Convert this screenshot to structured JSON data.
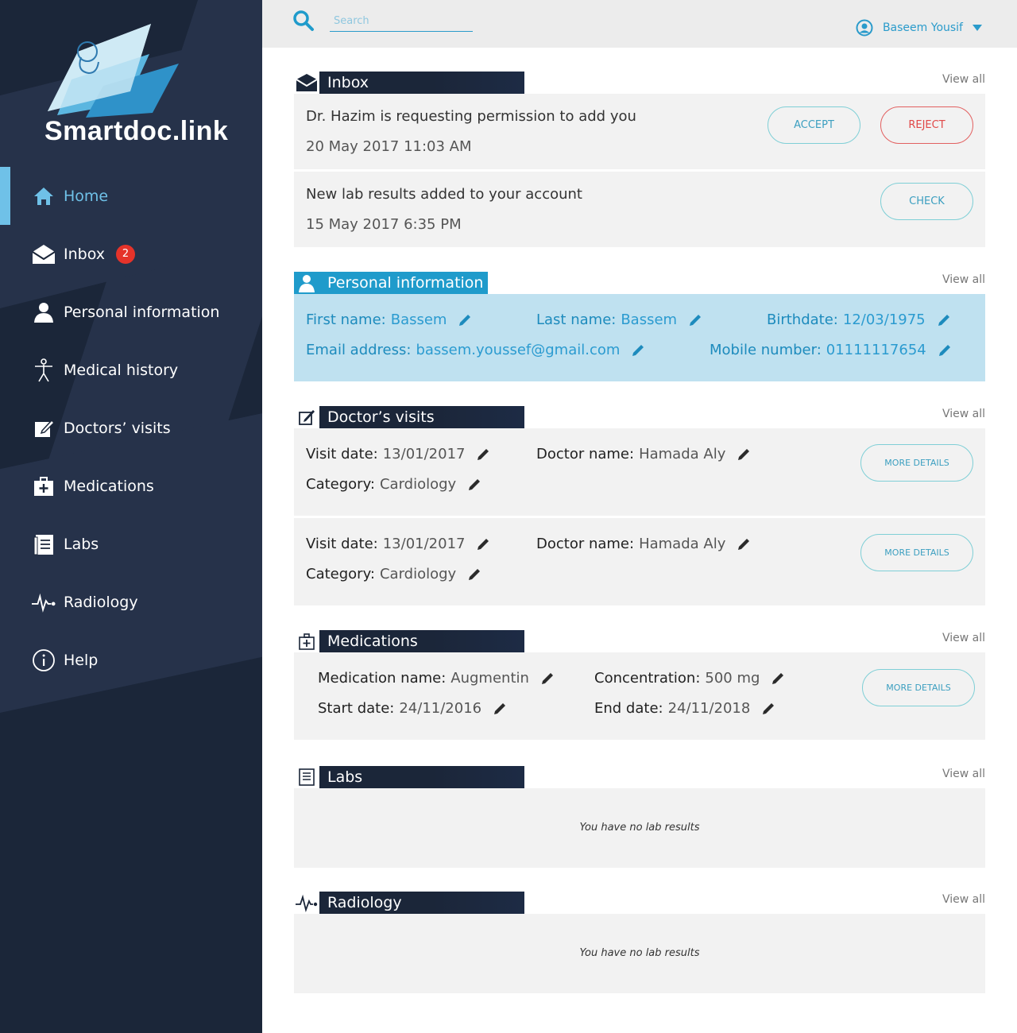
{
  "brand": {
    "name": "Smartdoc.link"
  },
  "sidebar": {
    "items": [
      {
        "label": "Home",
        "icon": "home-icon"
      },
      {
        "label": "Inbox",
        "icon": "envelope-icon",
        "badge": "2"
      },
      {
        "label": "Personal information",
        "icon": "person-icon"
      },
      {
        "label": "Medical history",
        "icon": "body-icon"
      },
      {
        "label": "Doctors’ visits",
        "icon": "edit-icon"
      },
      {
        "label": "Medications",
        "icon": "medkit-icon"
      },
      {
        "label": "Labs",
        "icon": "labs-icon"
      },
      {
        "label": "Radiology",
        "icon": "pulse-icon"
      },
      {
        "label": "Help",
        "icon": "info-icon"
      }
    ]
  },
  "topbar": {
    "search_placeholder": "Search",
    "user_name": "Baseem Yousif"
  },
  "common": {
    "view_all": "View all"
  },
  "inbox": {
    "title": "Inbox",
    "items": [
      {
        "message": "Dr. Hazim is requesting permission to add you",
        "date": "20 May 2017 11:03 AM",
        "accept": "ACCEPT",
        "reject": "REJECT"
      },
      {
        "message": "New lab results added to your account",
        "date": "15 May 2017 6:35 PM",
        "check": "CHECK"
      }
    ]
  },
  "personal": {
    "title": "Personal information",
    "first_name_label": "First name:",
    "first_name": "Bassem",
    "last_name_label": "Last name:",
    "last_name": "Bassem",
    "birthdate_label": "Birthdate:",
    "birthdate": "12/03/1975",
    "email_label": "Email address:",
    "email": "bassem.youssef@gmail.com",
    "mobile_label": "Mobile number:",
    "mobile": "01111117654"
  },
  "visits": {
    "title": "Doctor’s visits",
    "items": [
      {
        "visit_date_label": "Visit date:",
        "visit_date": "13/01/2017",
        "doctor_label": "Doctor name:",
        "doctor": "Hamada Aly",
        "category_label": "Category:",
        "category": "Cardiology",
        "more": "MORE DETAILS"
      },
      {
        "visit_date_label": "Visit date:",
        "visit_date": "13/01/2017",
        "doctor_label": "Doctor name:",
        "doctor": "Hamada Aly",
        "category_label": "Category:",
        "category": "Cardiology",
        "more": "MORE DETAILS"
      }
    ]
  },
  "medications": {
    "title": "Medications",
    "name_label": "Medication name:",
    "name": "Augmentin",
    "conc_label": "Concentration:",
    "conc": "500 mg",
    "start_label": "Start date:",
    "start": "24/11/2016",
    "end_label": "End date:",
    "end": "24/11/2018",
    "more": "MORE DETAILS"
  },
  "labs": {
    "title": "Labs",
    "empty": "You have no lab results"
  },
  "radiology": {
    "title": "Radiology",
    "empty": "You have no lab results"
  },
  "colors": {
    "sidebar": "#1b2639",
    "accent": "#6fc1e8",
    "teal": "#2a9bcb",
    "badge": "#e5332a"
  }
}
